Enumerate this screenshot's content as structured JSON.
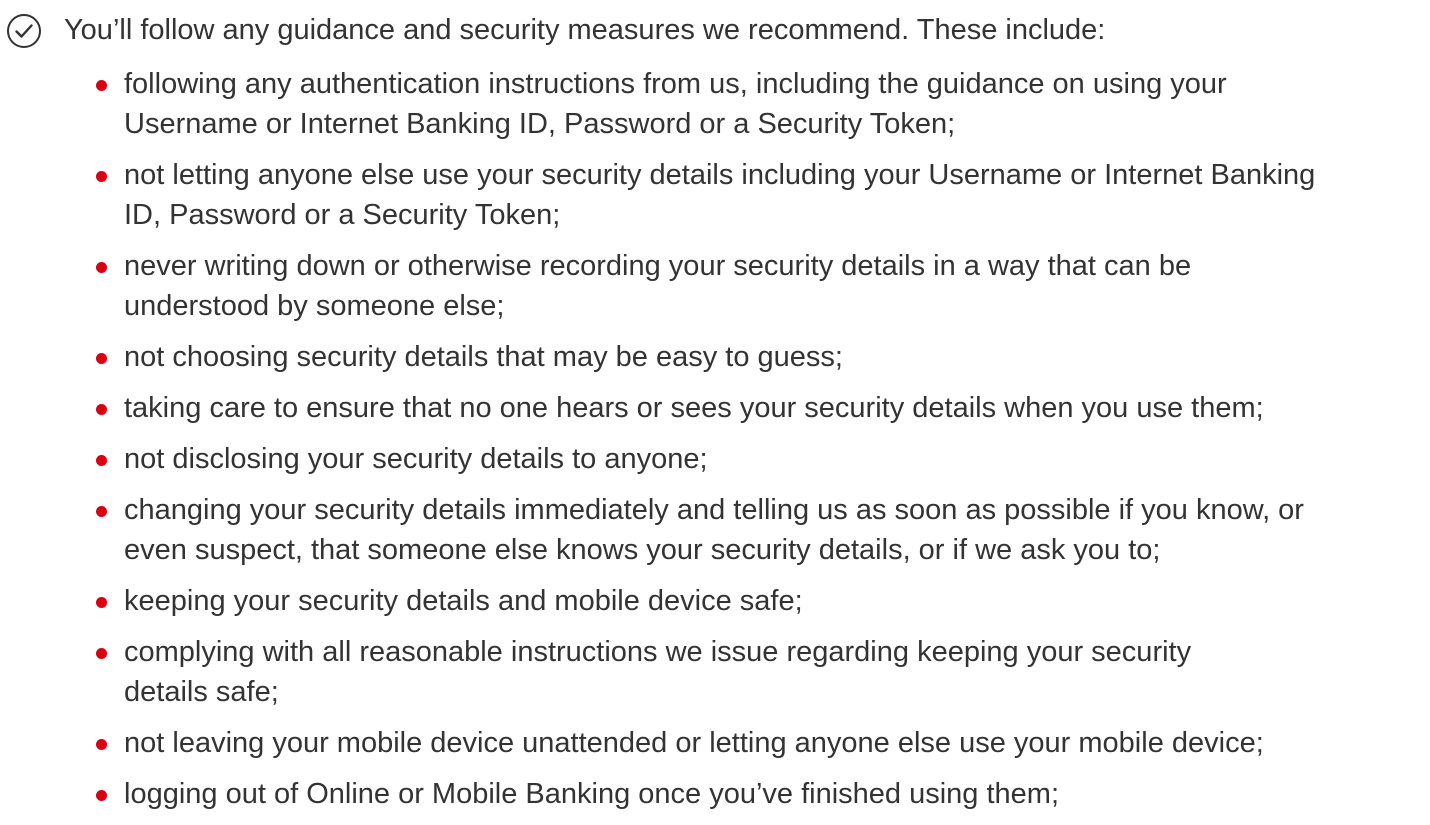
{
  "clause": {
    "icon": "check-circle-icon",
    "intro": "You’ll follow any guidance and security measures we recommend. These include:",
    "bullet_color": "#db0011",
    "text_color": "#333333",
    "items": [
      {
        "line1": "following any authentication instructions from us, including the guidance on using your",
        "line2": "Username or Internet Banking ID, Password or a Security Token;"
      },
      {
        "line1": "not letting anyone else use your security details including your Username or Internet Banking",
        "line2": "ID, Password or a Security Token;"
      },
      {
        "line1": "never writing down or otherwise recording your security details in a way that can be",
        "line2": "understood by someone else;"
      },
      {
        "line1": "not choosing security details that may be easy to guess;",
        "line2": ""
      },
      {
        "line1": "taking care to ensure that no one hears or sees your security details when you use them;",
        "line2": ""
      },
      {
        "line1": "not disclosing your security details to anyone;",
        "line2": ""
      },
      {
        "line1": "changing your security details immediately and telling us as soon as possible if you know, or",
        "line2": "even suspect, that someone else knows your security details, or if we ask you to;"
      },
      {
        "line1": "keeping your security details and mobile device safe;",
        "line2": ""
      },
      {
        "line1": "complying with all reasonable instructions we issue regarding keeping your security",
        "line2": "details safe;"
      },
      {
        "line1": "not leaving your mobile device unattended or letting anyone else use your mobile device;",
        "line2": ""
      },
      {
        "line1": "logging out of Online or Mobile Banking once you’ve finished using them;",
        "line2": ""
      }
    ]
  }
}
